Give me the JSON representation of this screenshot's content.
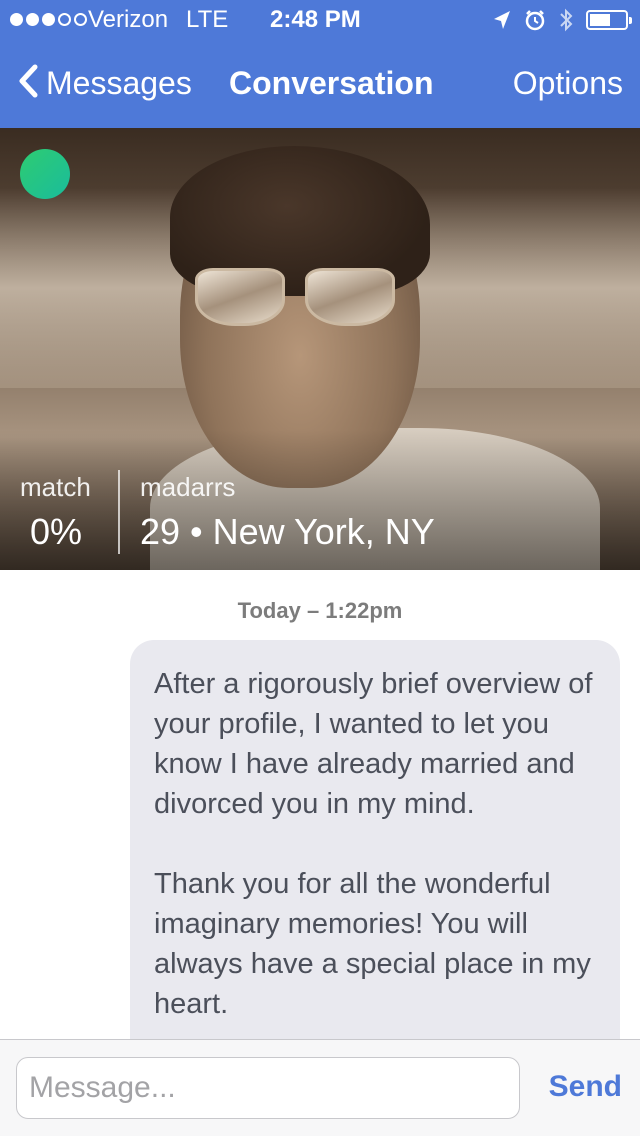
{
  "status_bar": {
    "signal_bars_filled": 3,
    "signal_bars_total": 5,
    "carrier": "Verizon",
    "network": "LTE",
    "time": "2:48 PM",
    "icons": [
      "location-arrow-icon",
      "alarm-clock-icon",
      "bluetooth-icon",
      "battery-icon"
    ],
    "battery_level": 0.6
  },
  "nav": {
    "back_label": "Messages",
    "title": "Conversation",
    "options_label": "Options",
    "color": "#4e79d8"
  },
  "profile": {
    "online_status_color": "#2ecc71",
    "match_label": "match",
    "match_value": "0%",
    "username": "madarrs",
    "details": "29 • New York, NY"
  },
  "conversation": {
    "timestamp": "Today – 1:22pm",
    "messages": [
      {
        "text": "After a rigorously brief overview of your profile, I wanted to let you know I have already married and divorced you in my mind.\n\nThank you for all the wonderful imaginary memories! You will always have a special place in my heart."
      }
    ]
  },
  "composer": {
    "placeholder": "Message...",
    "send_label": "Send"
  }
}
